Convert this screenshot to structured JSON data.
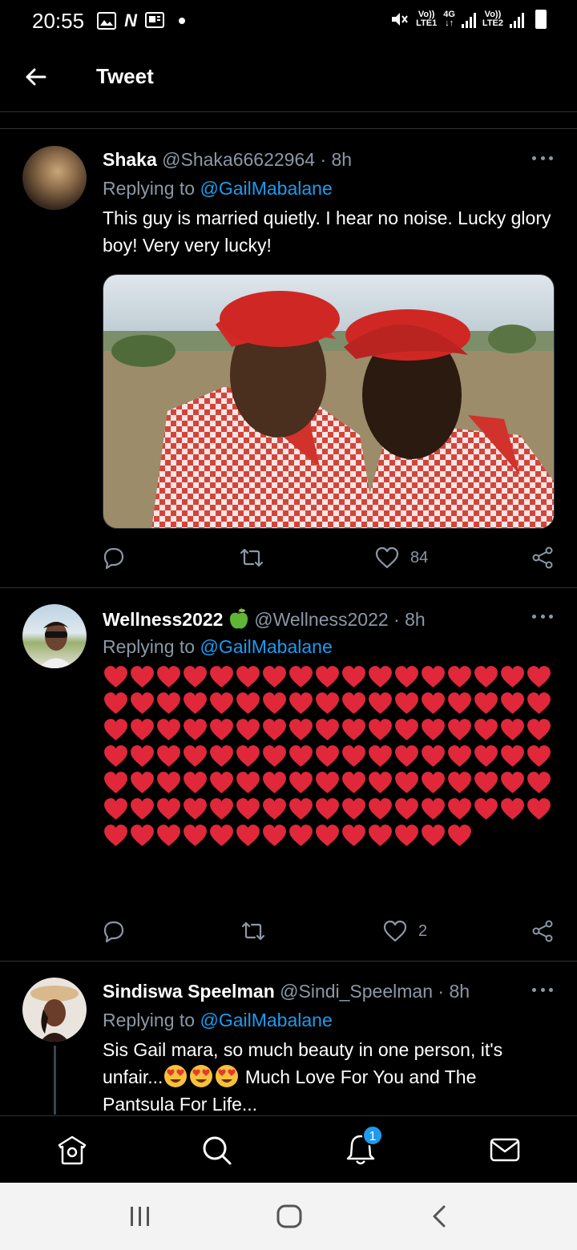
{
  "status_bar": {
    "time": "20:55",
    "sim1_label": "Vo))",
    "sim1_sub": "LTE1",
    "net_label": "4G",
    "sim2_label": "Vo))",
    "sim2_sub": "LTE2"
  },
  "header": {
    "title": "Tweet"
  },
  "tweets": [
    {
      "name": "Shaka",
      "handle": "@Shaka66622964",
      "time": "· 8h",
      "replying_prefix": "Replying to ",
      "replying_to": "@GailMabalane",
      "text": "This guy is married quietly. I hear no noise. Lucky glory boy! Very very  lucky!",
      "likes": "84"
    },
    {
      "name": "Wellness2022",
      "handle": "@Wellness2022",
      "time": "· 8h",
      "replying_prefix": "Replying to ",
      "replying_to": "@GailMabalane",
      "heart_count": 116,
      "likes": "2"
    },
    {
      "name": "Sindiswa Speelman",
      "handle": "@Sindi_Speelman",
      "time": "· 8h",
      "replying_prefix": "Replying to ",
      "replying_to": "@GailMabalane",
      "text_part1": "Sis Gail mara, so much beauty in one person, it's unfair...",
      "text_part2": " Much Love For You and The Pantsula For Life..."
    }
  ],
  "bottom_nav": {
    "notifications_badge": "1"
  },
  "colors": {
    "accent": "#1d9bf0",
    "heart": "#e0283a",
    "muted": "#8b98a5",
    "divider": "#2f3336"
  }
}
